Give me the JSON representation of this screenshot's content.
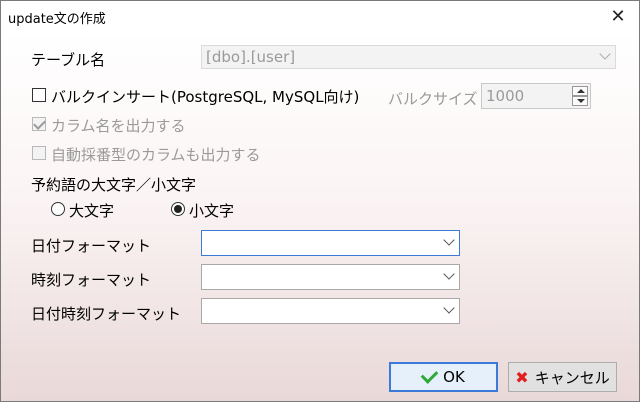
{
  "window": {
    "title": "update文の作成",
    "close_symbol": "✕"
  },
  "table": {
    "label": "テーブル名",
    "value": "[dbo].[user]"
  },
  "bulk_insert": {
    "label": "バルクインサート(PostgreSQL, MySQL向け)",
    "checked": false,
    "size_label": "バルクサイズ",
    "size_value": "1000"
  },
  "column_names": {
    "label": "カラム名を出力する",
    "checked": true,
    "enabled": false
  },
  "auto_number": {
    "label": "自動採番型のカラムも出力する",
    "checked": false,
    "enabled": false
  },
  "reserved_words": {
    "label": "予約語の大文字／小文字",
    "options": [
      {
        "label": "大文字",
        "selected": false
      },
      {
        "label": "小文字",
        "selected": true
      }
    ]
  },
  "formats": [
    {
      "label": "日付フォーマット",
      "value": ""
    },
    {
      "label": "時刻フォーマット",
      "value": ""
    },
    {
      "label": "日付時刻フォーマット",
      "value": ""
    }
  ],
  "buttons": {
    "ok": "OK",
    "cancel": "キャンセル"
  },
  "colors": {
    "accent": "#3b7ad8",
    "ok_icon": "#2fa83a",
    "cancel_icon": "#e0201e"
  }
}
